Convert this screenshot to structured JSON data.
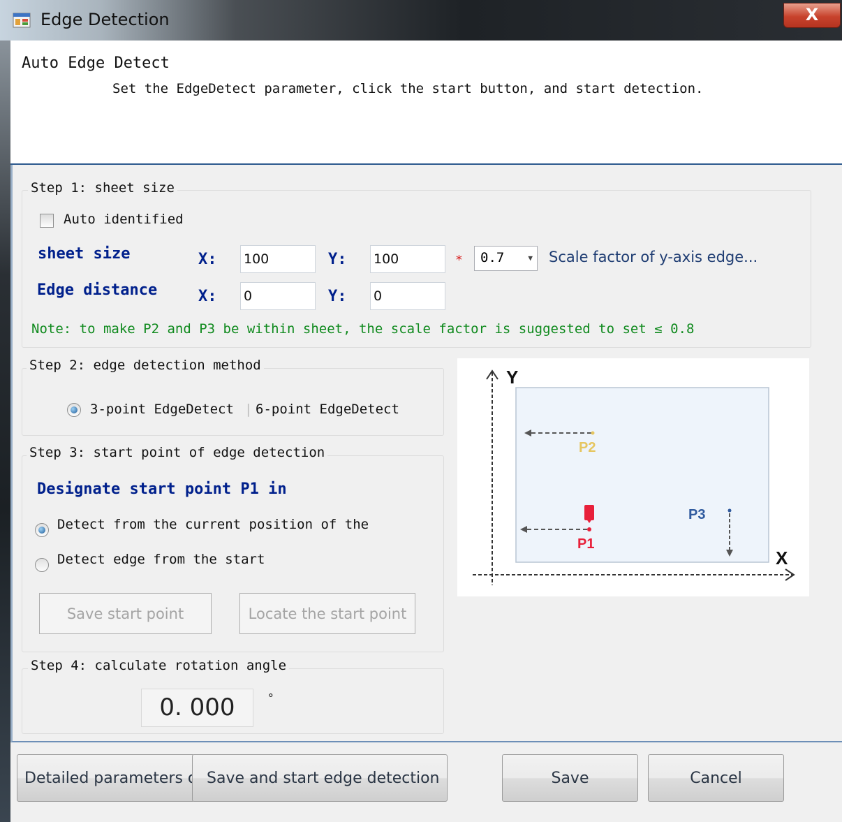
{
  "window": {
    "title": "Edge Detection",
    "close_glyph": "X"
  },
  "header": {
    "title": "Auto Edge Detect",
    "subtitle": "Set the EdgeDetect parameter, click the start button, and start detection."
  },
  "step1": {
    "label": "Step 1: sheet size",
    "auto_identified": "Auto identified",
    "sheet_size_label": "sheet size",
    "edge_distance_label": "Edge distance",
    "x_label": "X:",
    "y_label": "Y:",
    "sheet_x": "100",
    "sheet_y": "100",
    "star": "*",
    "scale_value": "0.7",
    "scale_label": "Scale factor of y-axis edge...",
    "edge_x": "0",
    "edge_y": "0",
    "note": "Note: to make P2 and P3 be within sheet, the scale factor is suggested to set ≤ 0.8"
  },
  "step2": {
    "label": "Step 2: edge detection method",
    "opt_3": "3-point EdgeDetect",
    "opt_6": "6-point EdgeDetect"
  },
  "step3": {
    "label": "Step 3: start point of edge detection",
    "heading": "Designate start point P1 in",
    "opt_current": "Detect from the current position of the",
    "opt_start": "Detect edge from the start",
    "save_start": "Save start point",
    "locate_start": "Locate the start point"
  },
  "step4": {
    "label": "Step 4: calculate rotation angle",
    "angle": "0. 000",
    "unit": "°"
  },
  "diagram": {
    "y": "Y",
    "x": "X",
    "p1": "P1",
    "p2": "P2",
    "p3": "P3"
  },
  "footer": {
    "detailed": "Detailed parameters of",
    "save_start_detect": "Save and start edge detection",
    "save": "Save",
    "cancel": "Cancel"
  },
  "colors": {
    "accent_blue": "#00208c",
    "note_green": "#108a1e",
    "p1_red": "#e8203a",
    "p2_yellow": "#e6c660",
    "p3_blue": "#2f5a9e"
  }
}
